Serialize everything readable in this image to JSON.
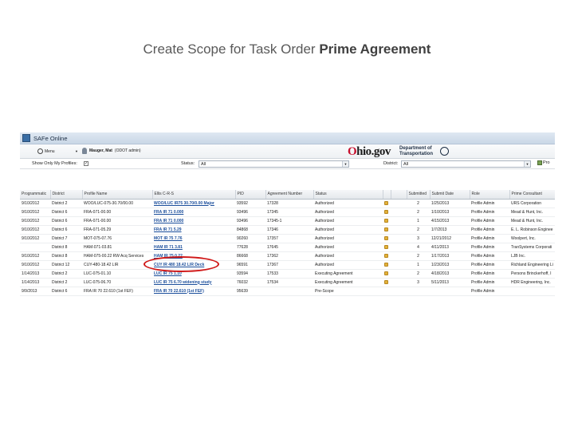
{
  "slide": {
    "title_prefix": "Create Scope for Task Order ",
    "title_bold": "Prime Agreement"
  },
  "app": {
    "window_title": "SAFe Online"
  },
  "menubar": {
    "menu_label": "Menu",
    "user_name": "Mauger, Mat",
    "user_role": "(ODOT admin)",
    "logo_prefix": "O",
    "logo_rest": "hio.gov",
    "dept_line1": "Department of",
    "dept_line2": "Transportation"
  },
  "filters": {
    "only_my_profiles_label": "Show Only My Profiles:",
    "only_my_profiles_checked": "✓",
    "status_label": "Status:",
    "status_value": "All",
    "district_label": "District:",
    "district_value": "All",
    "pro_button": "Pro"
  },
  "table": {
    "headers": [
      "Programmatic",
      "District",
      "Profile Name",
      "Ellis C-R-S",
      "PID",
      "Agreement Number",
      "Status",
      "",
      "",
      "Submitted",
      "Submit Date",
      "Role",
      "Prime Consultant"
    ],
    "rows": [
      [
        "9/10/2012",
        "District 2",
        "WOO/LUC-075-30.70/00.00",
        "WOO/LUC IR75 30.70/0.00 Major",
        "93592",
        "17328",
        "Authorized",
        "2",
        "1/25/2013",
        "Profile Admin",
        "URS Corporation"
      ],
      [
        "9/10/2012",
        "District 6",
        "FRA-071-00.00",
        "FRA IR 71 0.000",
        "93496",
        "17345",
        "Authorized",
        "2",
        "1/10/2013",
        "Profile Admin",
        "Mead & Hunt, Inc."
      ],
      [
        "9/10/2012",
        "District 6",
        "FRA-071-00.00",
        "FRA IR 71 0.000",
        "93496",
        "17345-1",
        "Authorized",
        "1",
        "4/15/2013",
        "Profile Admin",
        "Mead & Hunt, Inc."
      ],
      [
        "9/10/2012",
        "District 6",
        "FRA-071-05.29",
        "FRA IR 71 5.29",
        "84868",
        "17346",
        "Authorized",
        "2",
        "1/7/2013",
        "Profile Admin",
        "E. L. Robinson Enginee"
      ],
      [
        "9/10/2012",
        "District 7",
        "MOT-075-07.76",
        "MOT IR 75 7.76",
        "90260",
        "17357",
        "Authorized",
        "3",
        "12/21/2012",
        "Profile Admin",
        "Woolpert, Inc."
      ],
      [
        "",
        "District 8",
        "HAM-071-03.81",
        "HAM IR 71 3.81",
        "77628",
        "17645",
        "Authorized",
        "4",
        "4/11/2013",
        "Profile Admin",
        "TranSystems Corporati"
      ],
      [
        "9/10/2012",
        "District 8",
        "HAM-075-00.22 RW Acq Services",
        "HAM IR 75 0.22",
        "86668",
        "17362",
        "Authorized",
        "2",
        "1/17/2013",
        "Profile Admin",
        "LJB Inc."
      ],
      [
        "9/10/2012",
        "District 12",
        "CUY-480-18.42 LIR",
        "CUY IR 480 18.42 LIR Deck",
        "96591",
        "17367",
        "Authorized",
        "1",
        "1/23/2013",
        "Profile Admin",
        "Richland Engineering Li"
      ],
      [
        "1/14/2013",
        "District 2",
        "LUC-075-01.10",
        "LUC IR 75 1.10",
        "93594",
        "17533",
        "Executing Agreement",
        "2",
        "4/18/2013",
        "Profile Admin",
        "Persons Brinckerhoff, I"
      ],
      [
        "1/14/2013",
        "District 2",
        "LUC-075-06.70",
        "LUC IR 75 6.70 widening study",
        "76032",
        "17534",
        "Executing Agreement",
        "3",
        "5/11/2013",
        "Profile Admin",
        "HDR Engineering, Inc."
      ],
      [
        "9/9/2013",
        "District 6",
        "FRA IR 70 22.610 (1st FEF)",
        "FRA IR 70 22.610 (1st FEF)",
        "95639",
        "",
        "Pre-Scope",
        "",
        "",
        "Profile Admin",
        ""
      ]
    ],
    "lock_rows": [
      true,
      true,
      true,
      true,
      true,
      true,
      true,
      true,
      true,
      true,
      false
    ]
  }
}
